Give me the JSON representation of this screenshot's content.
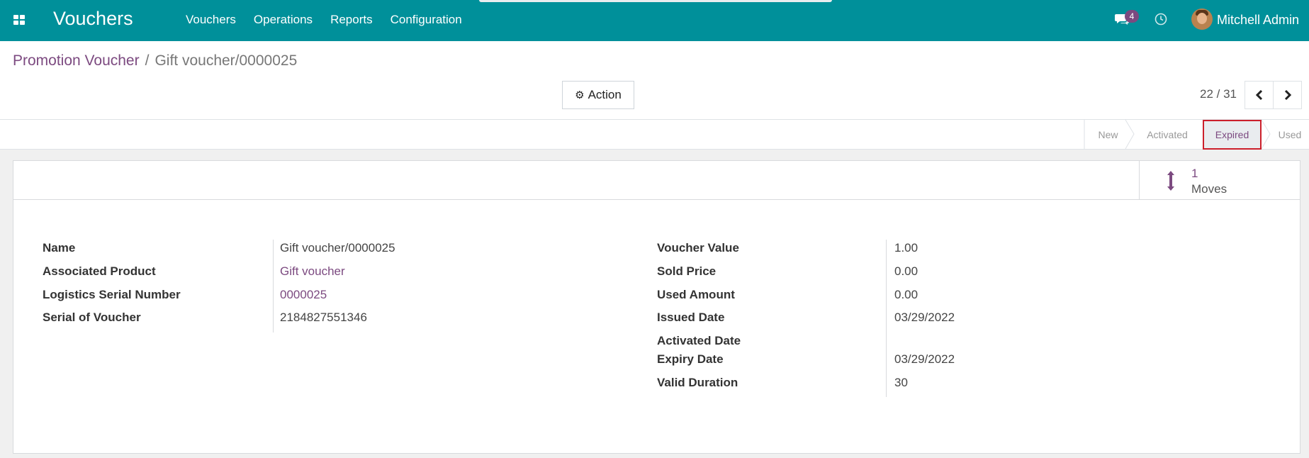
{
  "navbar": {
    "app_title": "Vouchers",
    "menu": [
      "Vouchers",
      "Operations",
      "Reports",
      "Configuration"
    ],
    "chat_badge": "4",
    "user_name": "Mitchell Admin",
    "accent_color": "#00909a"
  },
  "breadcrumb": {
    "parent": "Promotion Voucher",
    "separator": "/",
    "current": "Gift voucher/0000025"
  },
  "toolbar": {
    "action_label": "Action",
    "pager": "22 / 31"
  },
  "statusbar": {
    "stages": [
      "New",
      "Activated",
      "Expired",
      "Used"
    ],
    "active_stage": "Expired"
  },
  "smart_button": {
    "value": "1",
    "label": "Moves"
  },
  "form": {
    "left": [
      {
        "label": "Name",
        "value": "Gift voucher/0000025"
      },
      {
        "label": "Associated Product",
        "value": "Gift voucher"
      },
      {
        "label": "Logistics Serial Number",
        "value": "0000025"
      },
      {
        "label": "Serial of Voucher",
        "value": "2184827551346"
      }
    ],
    "right": [
      {
        "label": "Voucher Value",
        "value": "1.00"
      },
      {
        "label": "Sold Price",
        "value": "0.00"
      },
      {
        "label": "Used Amount",
        "value": "0.00"
      },
      {
        "label": "Issued Date",
        "value": "03/29/2022"
      },
      {
        "label": "Activated Date",
        "value": ""
      },
      {
        "label": "Expiry Date",
        "value": "03/29/2022"
      },
      {
        "label": "Valid Duration",
        "value": "30"
      }
    ]
  }
}
